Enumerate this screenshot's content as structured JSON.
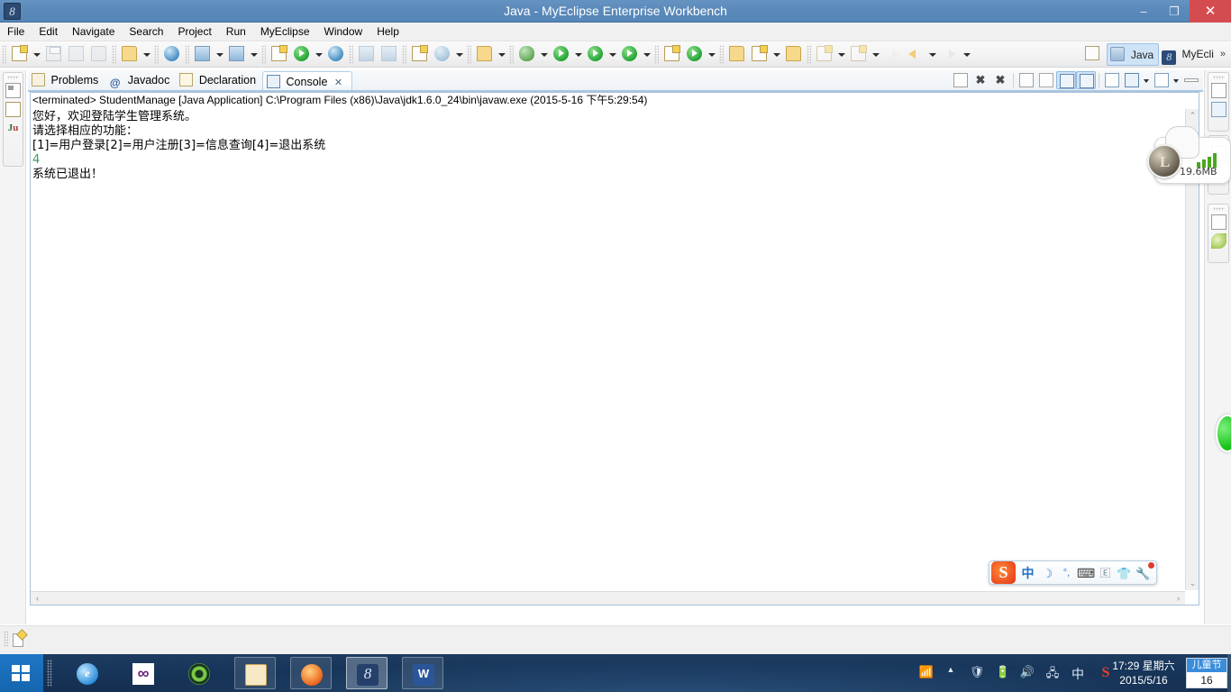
{
  "window": {
    "title": "Java - MyEclipse Enterprise Workbench",
    "app_icon": "myeclipse-icon",
    "minimize": "–",
    "maximize": "❐",
    "close": "✕"
  },
  "menubar": {
    "items": [
      "File",
      "Edit",
      "Navigate",
      "Search",
      "Project",
      "Run",
      "MyEclipse",
      "Window",
      "Help"
    ]
  },
  "toolbar": {
    "groups": [
      {
        "buttons": [
          {
            "name": "new-button",
            "icon": "new-doc-icon",
            "arrow": true
          },
          {
            "name": "save-button",
            "icon": "save-icon",
            "arrow": false
          },
          {
            "name": "save-all-button",
            "icon": "save-all-icon",
            "arrow": false
          },
          {
            "name": "print-button",
            "icon": "print-icon",
            "arrow": false
          }
        ]
      },
      {
        "buttons": [
          {
            "name": "deploy-button",
            "icon": "deploy-icon",
            "arrow": true
          }
        ]
      },
      {
        "buttons": [
          {
            "name": "web-browser-button",
            "icon": "globe-20-icon",
            "arrow": false
          }
        ]
      },
      {
        "buttons": [
          {
            "name": "new-server-button",
            "icon": "server-new-icon",
            "arrow": true
          },
          {
            "name": "manage-server-button",
            "icon": "server-icon",
            "arrow": true
          }
        ]
      },
      {
        "buttons": [
          {
            "name": "database-explorer-button",
            "icon": "db-explorer-icon",
            "arrow": false
          },
          {
            "name": "run-server-button",
            "icon": "run-server-icon",
            "arrow": true
          },
          {
            "name": "globe-button",
            "icon": "globe-icon",
            "arrow": false
          }
        ]
      },
      {
        "buttons": [
          {
            "name": "open-type-button",
            "icon": "open-type-icon",
            "arrow": false
          },
          {
            "name": "search-button",
            "icon": "search-icon",
            "arrow": false
          }
        ]
      },
      {
        "buttons": [
          {
            "name": "report-button",
            "icon": "report-icon",
            "arrow": false
          },
          {
            "name": "validate-button",
            "icon": "validate-icon",
            "arrow": true
          }
        ]
      },
      {
        "buttons": [
          {
            "name": "snapshot-button",
            "icon": "camera-icon",
            "arrow": true
          }
        ]
      },
      {
        "buttons": [
          {
            "name": "debug-button",
            "icon": "bug-icon",
            "arrow": true
          },
          {
            "name": "run-button",
            "icon": "run-green-icon",
            "arrow": true
          },
          {
            "name": "run-history-button",
            "icon": "run-history-icon",
            "arrow": true
          },
          {
            "name": "external-tools-button",
            "icon": "external-tools-icon",
            "arrow": true
          }
        ]
      },
      {
        "buttons": [
          {
            "name": "new-package-button",
            "icon": "package-new-icon",
            "arrow": false
          },
          {
            "name": "new-class-button",
            "icon": "class-new-icon",
            "arrow": true
          }
        ]
      },
      {
        "buttons": [
          {
            "name": "open-resource-button",
            "icon": "open-folder-icon",
            "arrow": false
          },
          {
            "name": "quick-fix-button",
            "icon": "pencil-icon",
            "arrow": true
          },
          {
            "name": "open-package-button",
            "icon": "open-package-icon",
            "arrow": false
          }
        ]
      },
      {
        "buttons": [
          {
            "name": "next-annotation-button",
            "icon": "next-annotation-icon",
            "arrow": true
          },
          {
            "name": "previous-annotation-button",
            "icon": "previous-annotation-icon",
            "arrow": true
          }
        ]
      },
      {
        "buttons": [
          {
            "name": "back-button",
            "icon": "back-arrow-icon",
            "arrow": false
          },
          {
            "name": "forward-yellow-button",
            "icon": "forward-arrow-yellow-icon",
            "arrow": true
          },
          {
            "name": "forward-button",
            "icon": "forward-arrow-icon",
            "arrow": true
          }
        ]
      }
    ]
  },
  "perspective": {
    "open_perspective_icon": "open-perspective-icon",
    "items": [
      {
        "label": "Java",
        "icon": "java-perspective-icon",
        "active": true
      },
      {
        "label": "MyEcli",
        "icon": "myeclipse-perspective-icon",
        "active": false
      }
    ],
    "overflow": "»"
  },
  "left_fast_view": {
    "items": [
      {
        "name": "outline-view-icon",
        "label": ""
      },
      {
        "name": "grid-view-icon",
        "label": ""
      },
      {
        "name": "junit-view-icon",
        "label": "Ju"
      }
    ]
  },
  "right_fast_view": {
    "stacks": [
      {
        "items": [
          "window-icon",
          "edit-pen-icon"
        ]
      },
      {
        "items": [
          "hierarchy-icon",
          "signal-bars-icon"
        ]
      },
      {
        "items": [
          "window-icon",
          "leaf-icon"
        ]
      }
    ]
  },
  "view_tabs": [
    {
      "label": "Problems",
      "icon": "problems-icon",
      "active": false,
      "closable": false
    },
    {
      "label": "Javadoc",
      "icon": "javadoc-icon",
      "active": false,
      "closable": false
    },
    {
      "label": "Declaration",
      "icon": "declaration-icon",
      "active": false,
      "closable": false
    },
    {
      "label": "Console",
      "icon": "console-icon",
      "active": true,
      "closable": true,
      "close_label": "✕"
    }
  ],
  "view_toolbar": {
    "buttons": [
      {
        "name": "terminate-all-button",
        "icon": "terminate-all-icon",
        "selected": false
      },
      {
        "name": "remove-launch-button",
        "icon": "remove-launch-icon",
        "selected": false
      },
      {
        "name": "remove-all-terminated-button",
        "icon": "remove-all-terminated-icon",
        "selected": false
      },
      {
        "name": "clear-console-button",
        "icon": "clear-console-icon",
        "selected": false
      },
      {
        "name": "scroll-lock-button",
        "icon": "scroll-lock-icon",
        "selected": false
      },
      {
        "name": "show-console-on-output-button",
        "icon": "show-console-output-icon",
        "selected": true
      },
      {
        "name": "show-console-on-error-button",
        "icon": "show-console-error-icon",
        "selected": true
      },
      {
        "name": "pin-console-button",
        "icon": "pin-console-icon",
        "selected": false
      },
      {
        "name": "display-selected-console-button",
        "icon": "display-console-icon",
        "selected": false
      },
      {
        "name": "open-console-button",
        "icon": "open-console-icon",
        "selected": false
      },
      {
        "name": "minimize-view-button",
        "icon": "minimize-icon",
        "selected": false
      }
    ]
  },
  "console": {
    "launch_line": "<terminated> StudentManage [Java Application] C:\\Program Files (x86)\\Java\\jdk1.6.0_24\\bin\\javaw.exe (2015-5-16 下午5:29:54)",
    "lines": [
      {
        "text": "您好，欢迎登陆学生管理系统。",
        "color": "black"
      },
      {
        "text": "请选择相应的功能：",
        "color": "black"
      },
      {
        "text": "[1]=用户登录[2]=用户注册[3]=信息查询[4]=退出系统",
        "color": "black"
      },
      {
        "text": "4",
        "color": "green"
      },
      {
        "text": "系统已退出！",
        "color": "black"
      }
    ],
    "scroll_up": "⌃",
    "scroll_down": "⌄",
    "scroll_left": "‹",
    "scroll_right": "›"
  },
  "memory_widget": {
    "label": "19.6MB",
    "icon": "memory-monitor-icon"
  },
  "ime_toolbar": {
    "logo": "S",
    "items": [
      {
        "name": "ime-mode-chinese",
        "glyph": "中"
      },
      {
        "name": "ime-moon-icon",
        "glyph": "☽"
      },
      {
        "name": "ime-punctuation-icon",
        "glyph": "°,"
      },
      {
        "name": "ime-soft-keyboard-icon",
        "glyph": "⌨"
      },
      {
        "name": "ime-input-method-icon",
        "glyph": "🄴"
      },
      {
        "name": "ime-skin-icon",
        "glyph": "👕"
      },
      {
        "name": "ime-toolbox-icon",
        "glyph": "🔧"
      }
    ]
  },
  "taskbar": {
    "start_button": "start-button",
    "items": [
      {
        "name": "taskbar-internet-explorer",
        "icon": "ie-icon",
        "glyph": "e",
        "state": "pinned"
      },
      {
        "name": "taskbar-visual-studio",
        "icon": "visual-studio-icon",
        "glyph": "∞",
        "state": "pinned"
      },
      {
        "name": "taskbar-spiral-app",
        "icon": "spiral-icon",
        "glyph": "",
        "state": "pinned"
      },
      {
        "name": "taskbar-file-explorer",
        "icon": "file-explorer-icon",
        "glyph": "",
        "state": "open"
      },
      {
        "name": "taskbar-firefox",
        "icon": "firefox-icon",
        "glyph": "",
        "state": "open"
      },
      {
        "name": "taskbar-myeclipse",
        "icon": "myeclipse-icon",
        "glyph": "8",
        "state": "active"
      },
      {
        "name": "taskbar-word",
        "icon": "word-icon",
        "glyph": "W",
        "state": "open"
      }
    ],
    "tray": [
      {
        "name": "tray-wifi-icon",
        "glyph": "📶"
      },
      {
        "name": "tray-show-hidden-icon",
        "glyph": "▲"
      },
      {
        "name": "tray-security-icon",
        "glyph": "🛡"
      },
      {
        "name": "tray-battery-icon",
        "glyph": "🔋"
      },
      {
        "name": "tray-volume-icon",
        "glyph": "🔊"
      },
      {
        "name": "tray-network-icon",
        "glyph": "🖧"
      },
      {
        "name": "tray-ime-icon",
        "glyph": "中"
      },
      {
        "name": "tray-sogou-icon",
        "glyph": "S"
      }
    ],
    "clock": {
      "time": "17:29 星期六",
      "date": "2015/5/16"
    },
    "calendar_widget": {
      "festival": "儿童节",
      "day": "16"
    }
  }
}
